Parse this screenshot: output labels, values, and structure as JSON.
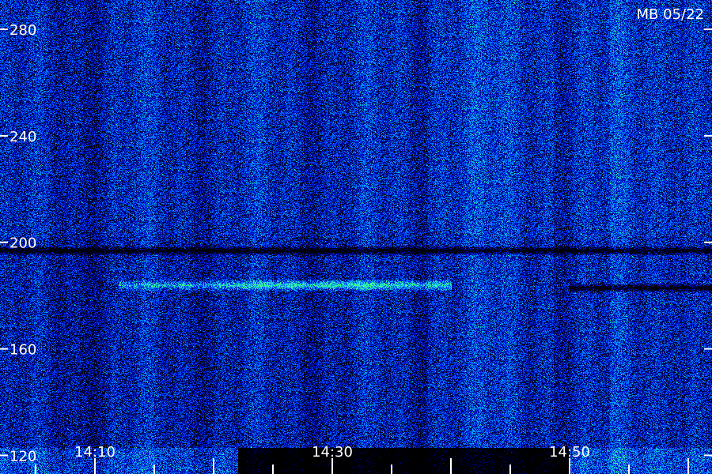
{
  "chart_data": {
    "type": "heatmap",
    "title": "MB 05/22",
    "xlabel": "",
    "ylabel": "",
    "x_ticks": [
      "14:10",
      "14:30",
      "14:50"
    ],
    "y_ticks": [
      "280",
      "240",
      "200",
      "160",
      "120"
    ],
    "y_tick_values": [
      280,
      240,
      200,
      160,
      120
    ],
    "x_tick_values": [
      "14:10",
      "14:30",
      "14:50"
    ],
    "ylim": [
      113,
      291
    ],
    "xlim": [
      "14:02",
      "15:02"
    ],
    "grid": false,
    "colormap": [
      "#000000",
      "#000088",
      "#0030ff",
      "#00a0ff",
      "#40ff90"
    ],
    "features": [
      {
        "kind": "horizontal-band",
        "y": 184,
        "x_start": "14:12",
        "x_end": "14:40",
        "intensity": 0.85
      },
      {
        "kind": "dark-band",
        "y": 183,
        "x_start": "14:50",
        "x_end": "15:02"
      },
      {
        "kind": "dark-band",
        "y": 197,
        "x_start": "14:02",
        "x_end": "15:02"
      }
    ]
  }
}
